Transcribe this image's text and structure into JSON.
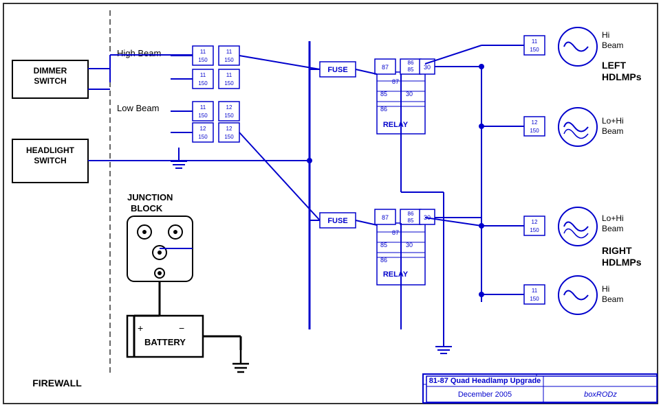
{
  "title": "81-87 Quad Headlamp Upgrade",
  "subtitle": "December 2005",
  "author": "boxRODz",
  "labels": {
    "dimmer_switch": "DIMMER\nSWITCH",
    "headlight_switch": "HEADLIGHT\nSWITCH",
    "junction_block": "JUNCTION\nBLOCK",
    "battery": "BATTERY",
    "firewall": "FIREWALL",
    "fuse1": "FUSE",
    "fuse2": "FUSE",
    "relay1": "RELAY",
    "relay2": "RELAY",
    "high_beam": "High Beam",
    "low_beam": "Low Beam",
    "left_hdlmps": "LEFT\nHDLMPs",
    "right_hdlmps": "RIGHT\nHDLMPs",
    "hi_beam_tl": "Hi\nBeam",
    "hi_beam_bl": "Hi\nBeam",
    "lo_hi_beam_l": "Lo+Hi\nBeam",
    "lo_hi_beam_r": "Lo+Hi\nBeam"
  }
}
